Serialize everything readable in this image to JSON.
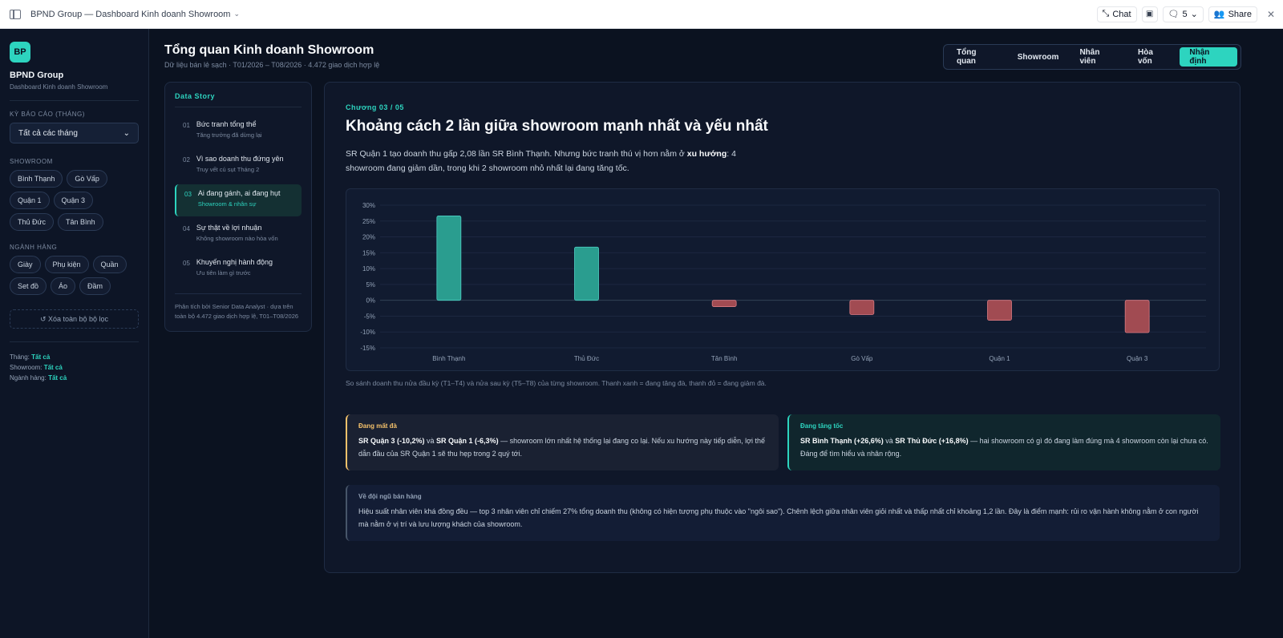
{
  "window": {
    "title": "BPND Group — Dashboard Kinh doanh Showroom",
    "chat_label": "Chat",
    "comments_count": "5",
    "share_label": "Share"
  },
  "sidebar": {
    "logo_text": "BP",
    "brand": "BPND Group",
    "brand_sub": "Dashboard Kinh doanh Showroom",
    "period_label": "KỲ BÁO CÁO (THÁNG)",
    "period_value": "Tất cả các tháng",
    "showroom_label": "SHOWROOM",
    "showrooms": [
      "Bình Thạnh",
      "Gò Vấp",
      "Quận 1",
      "Quận 3",
      "Thủ Đức",
      "Tân Bình"
    ],
    "category_label": "NGÀNH HÀNG",
    "categories": [
      "Giày",
      "Phụ kiện",
      "Quần",
      "Set đồ",
      "Áo",
      "Đầm"
    ],
    "clear_label": "↺ Xóa toàn bộ bộ lọc",
    "state": {
      "month_label": "Tháng:",
      "month_value": "Tất cả",
      "showroom_label": "Showroom:",
      "showroom_value": "Tất cả",
      "category_label": "Ngành hàng:",
      "category_value": "Tất cả"
    }
  },
  "header": {
    "title": "Tổng quan Kinh doanh Showroom",
    "subtitle": "Dữ liệu bán lẻ sạch · T01/2026 – T08/2026 · 4.472 giao dịch hợp lệ",
    "tabs": [
      "Tổng quan",
      "Showroom",
      "Nhân viên",
      "Hòa vốn",
      "Nhận định"
    ]
  },
  "story": {
    "heading": "Data Story",
    "items": [
      {
        "num": "01",
        "title": "Bức tranh tổng thể",
        "sub": "Tăng trưởng đã dừng lại"
      },
      {
        "num": "02",
        "title": "Vì sao doanh thu đứng yên",
        "sub": "Truy vết cú sụt Tháng 2"
      },
      {
        "num": "03",
        "title": "Ai đang gánh, ai đang hụt",
        "sub": "Showroom & nhân sự"
      },
      {
        "num": "04",
        "title": "Sự thật về lợi nhuận",
        "sub": "Không showroom nào hòa vốn"
      },
      {
        "num": "05",
        "title": "Khuyến nghị hành động",
        "sub": "Ưu tiên làm gì trước"
      }
    ],
    "footer": "Phân tích bởi Senior Data Analyst · dựa trên toàn bộ 4.472 giao dịch hợp lệ, T01–T08/2026"
  },
  "main": {
    "chapter": "Chương 03 / 05",
    "headline": "Khoảng cách 2 lần giữa showroom mạnh nhất và yếu nhất",
    "lede_part1": "SR Quận 1 tạo doanh thu gấp 2,08 lần SR Bình Thạnh. Nhưng bức tranh thú vị hơn nằm ở ",
    "lede_bold": "xu hướng",
    "lede_part2": ": 4 showroom đang giảm dần, trong khi 2 showroom nhỏ nhất lại đang tăng tốc.",
    "caption": "So sánh doanh thu nửa đầu kỳ (T1–T4) và nửa sau kỳ (T5–T8) của từng showroom. Thanh xanh = đang tăng đà, thanh đỏ = đang giảm đà.",
    "warn": {
      "title": "Đang mất đà",
      "b1": "SR Quận 3 (-10,2%)",
      "t1": " và ",
      "b2": "SR Quận 1 (-6,3%)",
      "t2": " — showroom lớn nhất hệ thống lại đang co lại. Nếu xu hướng này tiếp diễn, lợi thế dẫn đầu của SR Quận 1 sẽ thu hẹp trong 2 quý tới."
    },
    "good": {
      "title": "Đang tăng tốc",
      "b1": "SR Bình Thạnh (+26,6%)",
      "t1": " và ",
      "b2": "SR Thủ Đức (+16,8%)",
      "t2": " — hai showroom có gì đó đang làm đúng mà 4 showroom còn lại chưa có. Đáng để tìm hiểu và nhân rộng."
    },
    "team": {
      "title": "Về đội ngũ bán hàng",
      "body": "Hiệu suất nhân viên khá đồng đều — top 3 nhân viên chỉ chiếm 27% tổng doanh thu (không có hiện tượng phụ thuộc vào \"ngôi sao\"). Chênh lệch giữa nhân viên giỏi nhất và thấp nhất chỉ khoảng 1,2 lần. Đây là điểm mạnh: rủi ro vận hành không nằm ở con người mà nằm ở vị trí và lưu lượng khách của showroom."
    }
  },
  "chart_data": {
    "type": "bar",
    "categories": [
      "Bình Thạnh",
      "Thủ Đức",
      "Tân Bình",
      "Gò Vấp",
      "Quận 1",
      "Quận 3"
    ],
    "values": [
      26.6,
      16.8,
      -2.0,
      -4.5,
      -6.3,
      -10.2
    ],
    "ylim": [
      -15,
      30
    ],
    "yticks": [
      30,
      25,
      20,
      15,
      10,
      5,
      0,
      -5,
      -10,
      -15
    ],
    "ytick_labels": [
      "30%",
      "25%",
      "20%",
      "15%",
      "10%",
      "5%",
      "0%",
      "-5%",
      "-10%",
      "-15%"
    ],
    "colors": {
      "positive": "#2a9d8f",
      "negative": "#a14b52"
    },
    "grid": true
  }
}
